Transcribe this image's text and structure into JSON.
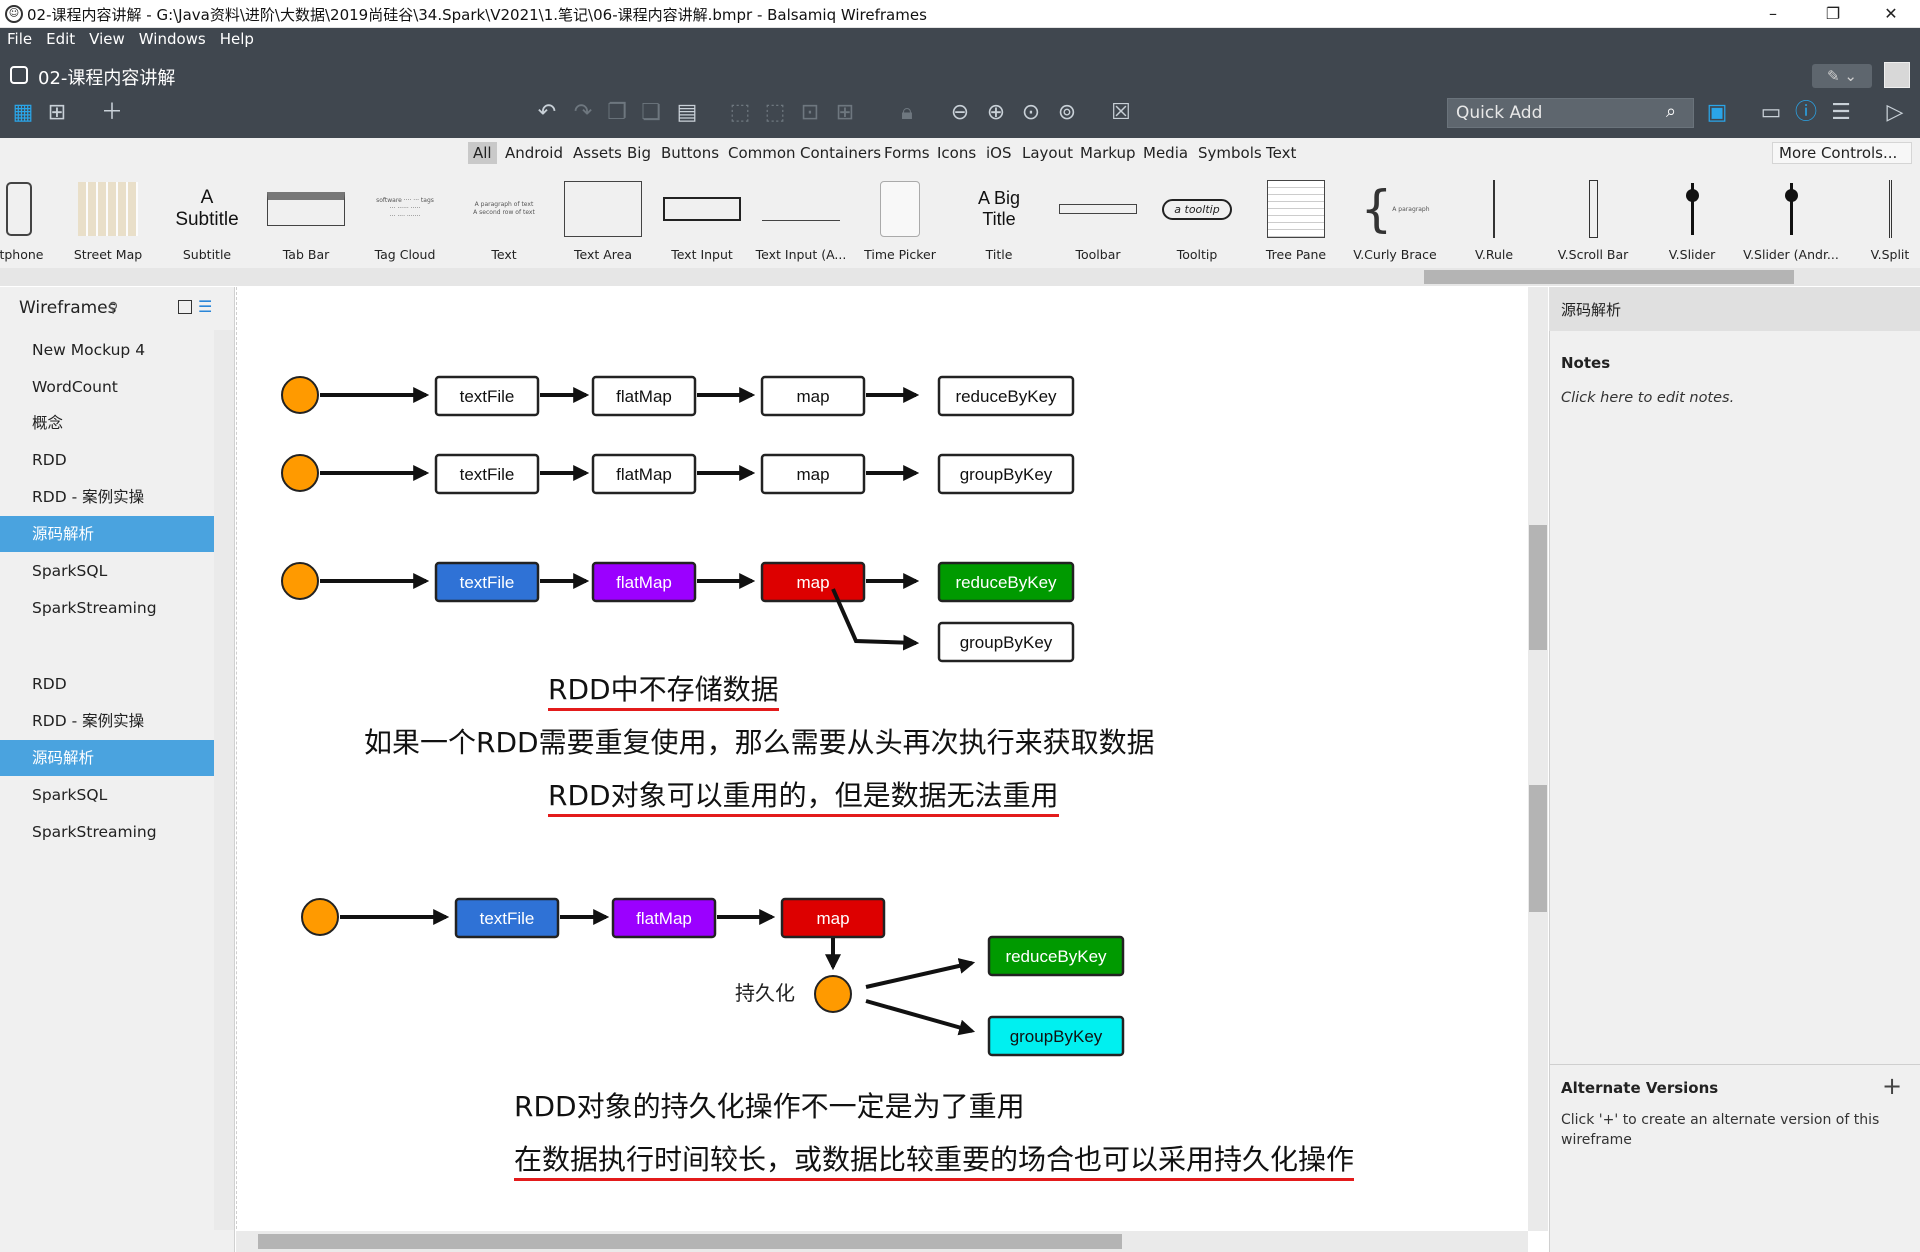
{
  "window": {
    "title": "02-课程内容讲解 - G:\\Java资料\\进阶\\大数据\\2019尚硅谷\\34.Spark\\V2021\\1.笔记\\06-课程内容讲解.bmpr - Balsamiq Wireframes",
    "minimize": "–",
    "restore": "❐",
    "close": "✕"
  },
  "menu": [
    "File",
    "Edit",
    "View",
    "Windows",
    "Help"
  ],
  "mockup_name": "02-课程内容讲解",
  "quick_add": {
    "placeholder": "Quick Add"
  },
  "library": {
    "categories": [
      "All",
      "Android",
      "Assets",
      "Big",
      "Buttons",
      "Common",
      "Containers",
      "Forms",
      "Icons",
      "iOS",
      "Layout",
      "Markup",
      "Media",
      "Symbols",
      "Text"
    ],
    "selected_category": "All",
    "more_controls": "More Controls...",
    "items": [
      "martphone",
      "Street Map",
      "Subtitle",
      "Tab Bar",
      "Tag Cloud",
      "Text",
      "Text Area",
      "Text Input",
      "Text Input (A...",
      "Time Picker",
      "Title",
      "Toolbar",
      "Tooltip",
      "Tree Pane",
      "V.Curly Brace",
      "V.Rule",
      "V.Scroll Bar",
      "V.Slider",
      "V.Slider (Andr...",
      "V.Split"
    ],
    "subtitle_sample": "A Subtitle",
    "title_sample": "A Big Title",
    "tooltip_sample": "a tooltip"
  },
  "sidebar": {
    "title": "Wireframes",
    "items": [
      "New Mockup 4",
      "WordCount",
      "概念",
      "RDD",
      "RDD - 案例实操",
      "源码解析",
      "SparkSQL",
      "SparkStreaming",
      "RDD",
      "RDD - 案例实操",
      "源码解析",
      "SparkSQL",
      "SparkStreaming"
    ],
    "selected_index": [
      5,
      10
    ]
  },
  "diagram": {
    "row1": [
      "textFile",
      "flatMap",
      "map",
      "reduceByKey"
    ],
    "row2": [
      "textFile",
      "flatMap",
      "map",
      "groupByKey"
    ],
    "row3": [
      "textFile",
      "flatMap",
      "map",
      "reduceByKey",
      "groupByKey"
    ],
    "row4": [
      "textFile",
      "flatMap",
      "map",
      "reduceByKey",
      "groupByKey"
    ],
    "persist_label": "持久化",
    "colors": {
      "blue": "#2f72d6",
      "purple": "#9b00ff",
      "red": "#dd0000",
      "green": "#009a00",
      "cyan": "#00f0f0",
      "orange": "#ff9a00"
    },
    "note1": "RDD中不存储数据",
    "note2": "如果一个RDD需要重复使用，那么需要从头再次执行来获取数据",
    "note3": "RDD对象可以重用的，但是数据无法重用",
    "note4": "RDD对象的持久化操作不一定是为了重用",
    "note5": "在数据执行时间较长，或数据比较重要的场合也可以采用持久化操作"
  },
  "right_panel": {
    "title": "源码解析",
    "notes_title": "Notes",
    "notes_hint": "Click here to edit notes.",
    "alt_title": "Alternate Versions",
    "alt_add": "+",
    "alt_hint": "Click '+' to create an alternate version of this wireframe"
  }
}
